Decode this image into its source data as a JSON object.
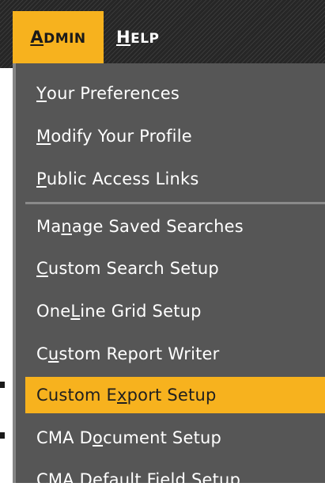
{
  "menubar": {
    "admin_label": "ADMIN",
    "help_label": "HELP"
  },
  "menu": {
    "groups": [
      [
        {
          "pre": "",
          "u": "Y",
          "post": "our Preferences"
        },
        {
          "pre": "",
          "u": "M",
          "post": "odify Your Profile"
        },
        {
          "pre": "",
          "u": "P",
          "post": "ublic Access Links"
        }
      ],
      [
        {
          "pre": "Ma",
          "u": "n",
          "post": "age Saved Searches"
        },
        {
          "pre": "",
          "u": "C",
          "post": "ustom Search Setup"
        },
        {
          "pre": "One ",
          "u": "L",
          "post": "ine Grid Setup"
        },
        {
          "pre": "C",
          "u": "u",
          "post": "stom Report Writer"
        },
        {
          "pre": "Custom E",
          "u": "x",
          "post": "port Setup",
          "highlighted": true
        },
        {
          "pre": "CMA D",
          "u": "o",
          "post": "cument Setup"
        },
        {
          "pre": "CMA Default Field Setup",
          "u": "",
          "post": ""
        }
      ]
    ]
  },
  "colors": {
    "accent": "#f7b21e",
    "menu_bg": "#565656",
    "menubar_bg": "#2c2c2c",
    "text": "#ffffff"
  }
}
